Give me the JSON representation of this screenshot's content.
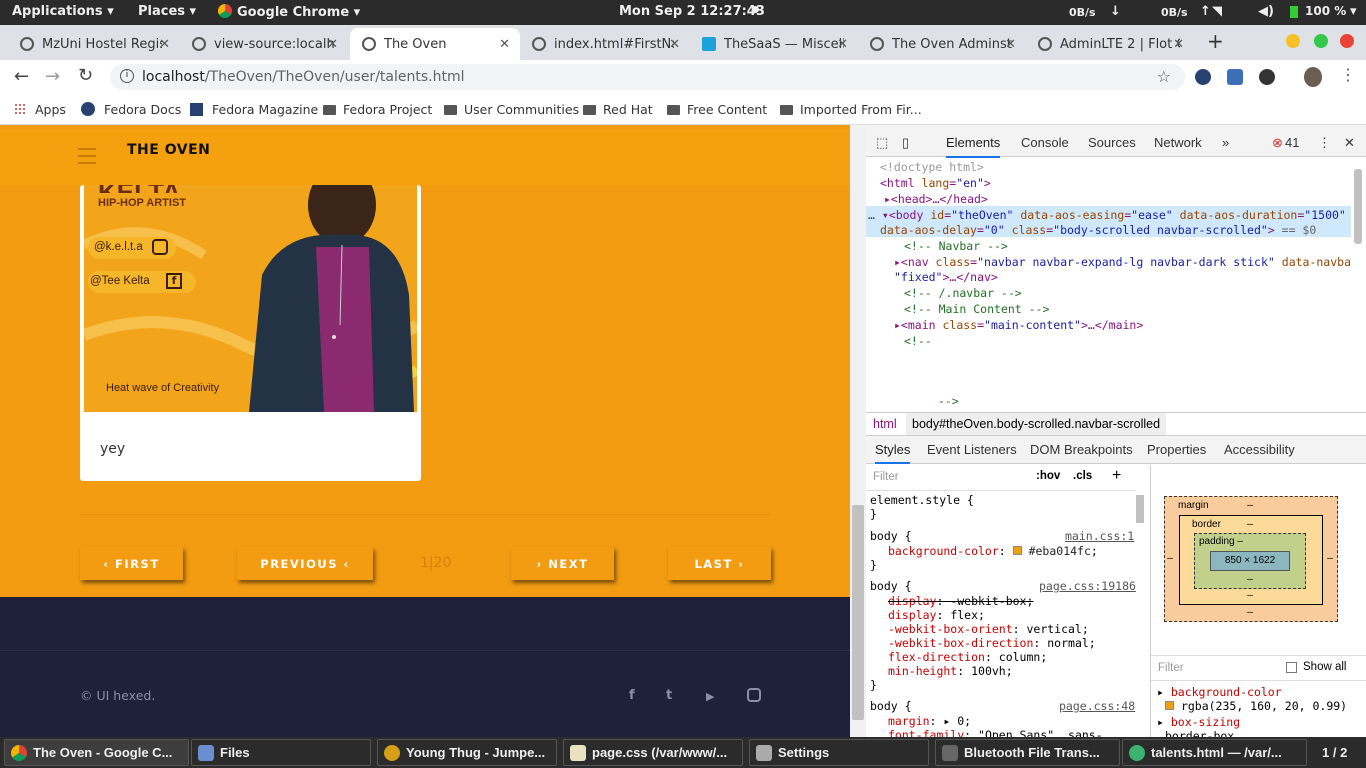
{
  "topbar": {
    "applications": "Applications",
    "places": "Places",
    "browser": "Google Chrome",
    "clock": "Mon Sep 2  12:27:43",
    "net_down": "0B/s",
    "net_up": "0B/s",
    "battery": "100 %"
  },
  "tabs": [
    {
      "label": "MzUni Hostel Regis"
    },
    {
      "label": "view-source:localho"
    },
    {
      "label": "The Oven"
    },
    {
      "label": "index.html#FirstNa"
    },
    {
      "label": "TheSaaS — Miscella"
    },
    {
      "label": "The Oven Adminstr"
    },
    {
      "label": "AdminLTE 2 | Flot C"
    }
  ],
  "omnibox": {
    "host": "localhost",
    "path": "/TheOven/TheOven/user/talents.html"
  },
  "bookmarks": [
    "Apps",
    "Fedora Docs",
    "Fedora Magazine",
    "Fedora Project",
    "User Communities",
    "Red Hat",
    "Free Content",
    "Imported From Fir..."
  ],
  "site": {
    "brand": "THE OVEN",
    "poster": {
      "name_fragment": "KELTA",
      "role": "HIP-HOP ARTIST",
      "instagram": "@k.e.l.t.a",
      "facebook": "@Tee Kelta",
      "tagline": "Heat wave of Creativity"
    },
    "caption": "yey",
    "first": "‹ FIRST",
    "previous": "PREVIOUS ‹",
    "page": "1|20",
    "next": "› NEXT",
    "last": "LAST ›",
    "copyright": "© UI hexed."
  },
  "devtools": {
    "tabs": [
      "Elements",
      "Console",
      "Sources",
      "Network",
      "»"
    ],
    "errors": "41",
    "subtabs": [
      "Styles",
      "Event Listeners",
      "DOM Breakpoints",
      "Properties",
      "Accessibility"
    ],
    "crumb_html": "html",
    "crumb_body": "body#theOven.body-scrolled.navbar-scrolled",
    "filter": "Filter",
    "hov": ":hov",
    "cls": ".cls",
    "box_margin": "margin",
    "box_border": "border",
    "box_padding": "padding –",
    "box_content": "850 × 1622",
    "dash": "–",
    "computed_filter": "Filter",
    "show_all": "Show all",
    "computed": [
      {
        "prop": "background-color",
        "val": "rgba(235, 160, 20, 0.99)"
      },
      {
        "prop": "box-sizing",
        "val": "border-box"
      }
    ]
  },
  "taskbar": [
    {
      "label": "The Oven - Google C..."
    },
    {
      "label": "Files"
    },
    {
      "label": "Young Thug - Jumpe..."
    },
    {
      "label": "page.css (/var/www/..."
    },
    {
      "label": "Settings"
    },
    {
      "label": "Bluetooth File Trans..."
    },
    {
      "label": "talents.html — /var/..."
    }
  ],
  "workspace": "1 / 2",
  "colors": {
    "page_bg": "#f39c12",
    "footer_bg": "#1e2139",
    "swatch": "#eba014"
  }
}
